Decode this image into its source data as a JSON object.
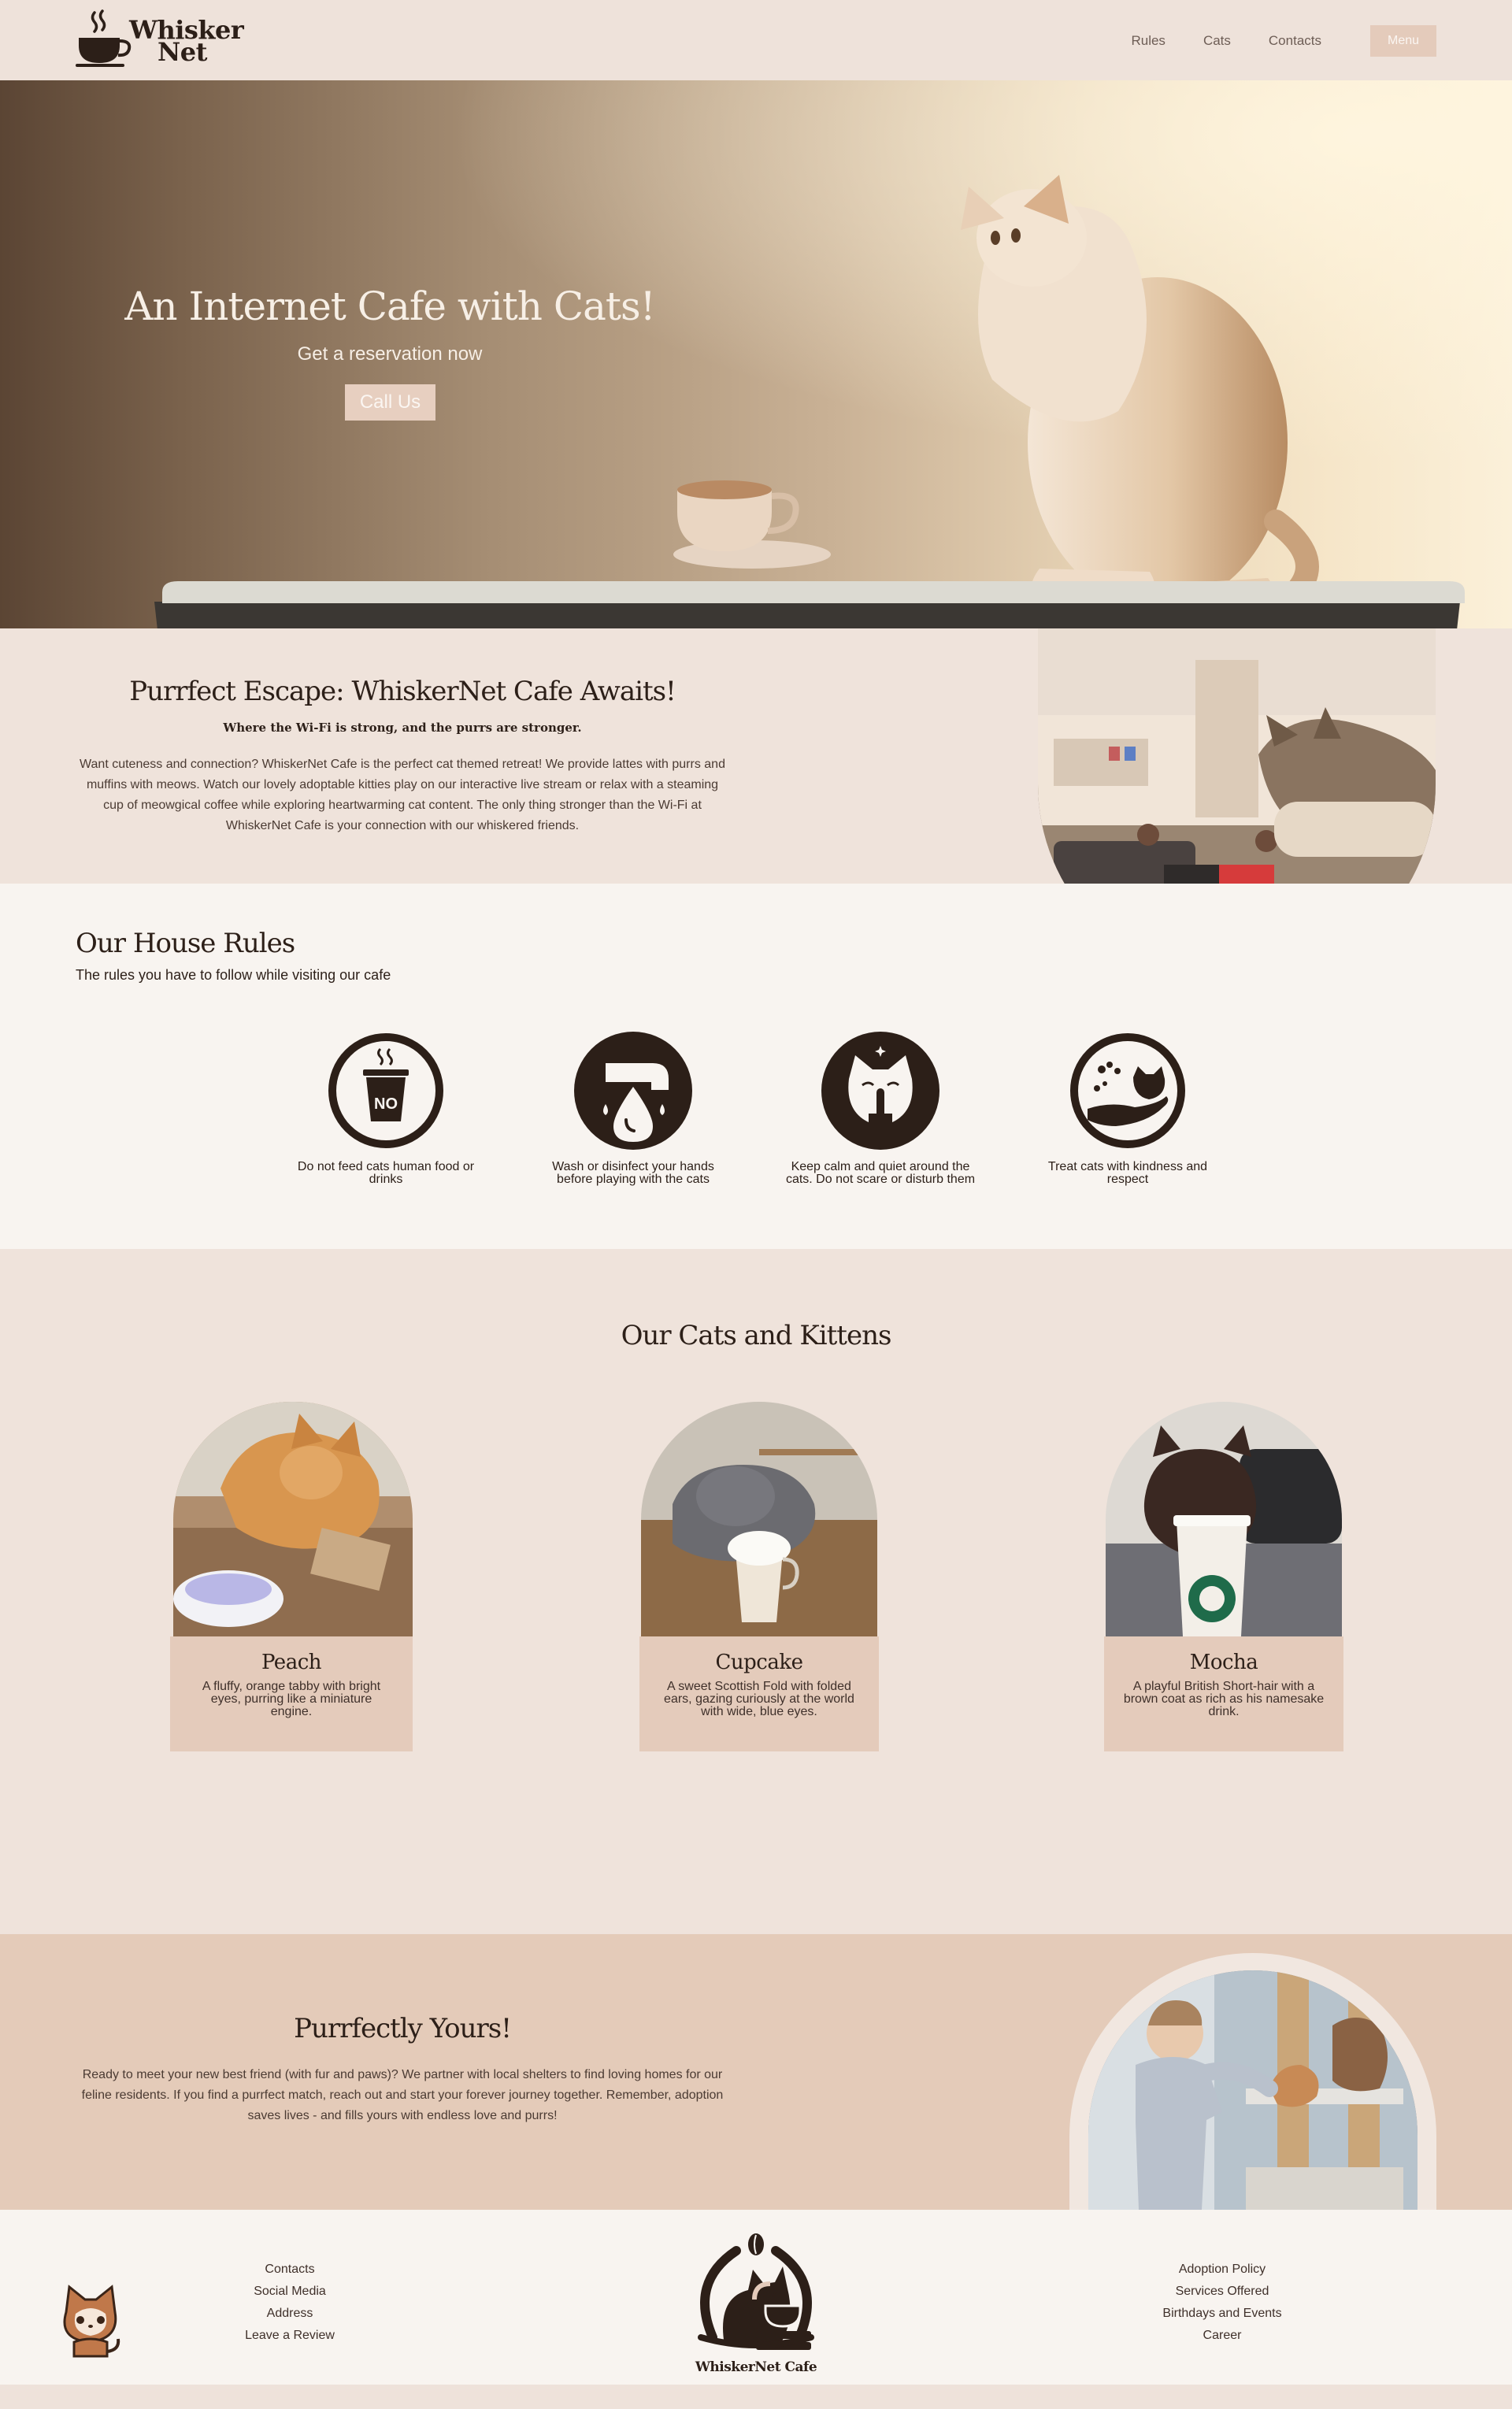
{
  "header": {
    "logo_line1": "Whisker",
    "logo_line2": "Net",
    "nav": [
      "Rules",
      "Cats",
      "Contacts"
    ],
    "menu_label": "Menu"
  },
  "hero": {
    "title": "An Internet Cafe with Cats!",
    "subtitle": "Get a reservation now",
    "button_label": "Call Us"
  },
  "escape": {
    "title": "Purrfect Escape: WhiskerNet Cafe Awaits!",
    "tagline": "Where the Wi-Fi is strong, and the purrs are stronger.",
    "text": "Want cuteness and connection? WhiskerNet Cafe is the perfect cat themed retreat! We provide lattes with purrs and muffins with meows. Watch our lovely adoptable kitties play on our interactive live stream or relax with a steaming cup of meowgical coffee while exploring heartwarming cat content. The only thing stronger than the Wi-Fi at WhiskerNet Cafe is your connection with our whiskered friends."
  },
  "rules": {
    "title": "Our House Rules",
    "subtitle": "The rules you have to follow while visiting our cafe",
    "items": [
      {
        "icon": "no-food-cup-icon",
        "text": "Do not feed cats human food or drinks"
      },
      {
        "icon": "wash-hands-icon",
        "text": "Wash or disinfect your hands before playing with the cats"
      },
      {
        "icon": "quiet-cat-icon",
        "text": "Keep calm and quiet around the cats. Do not scare or disturb them"
      },
      {
        "icon": "kind-hand-cat-icon",
        "text": "Treat cats with kindness and respect"
      }
    ],
    "icon_no_label": "NO"
  },
  "cats": {
    "title": "Our Cats and Kittens",
    "items": [
      {
        "name": "Peach",
        "description": "A fluffy, orange tabby with bright eyes, purring like a miniature engine."
      },
      {
        "name": "Cupcake",
        "description": "A sweet Scottish Fold with folded ears, gazing curiously at the world with wide, blue eyes."
      },
      {
        "name": "Mocha",
        "description": "A playful British Short-hair with a brown coat as rich as his namesake drink."
      }
    ]
  },
  "adoption": {
    "title": "Purrfectly Yours!",
    "text": "Ready to meet your new best friend (with fur and paws)? We partner with local shelters to find loving homes for our feline residents. If you find a purrfect match, reach out and start your forever journey together. Remember, adoption saves lives - and fills yours with endless love and purrs!"
  },
  "footer": {
    "left_links": [
      "Contacts",
      "Social Media",
      "Address",
      "Leave a Review"
    ],
    "logo_text": "WhiskerNet Cafe",
    "right_links": [
      "Adoption Policy",
      "Services Offered",
      "Birthdays and Events",
      "Career"
    ]
  },
  "colors": {
    "background": "#eee2da",
    "accent": "#e4cbbb",
    "text_dark": "#2c1f18",
    "light_section": "#f8f4f0"
  }
}
